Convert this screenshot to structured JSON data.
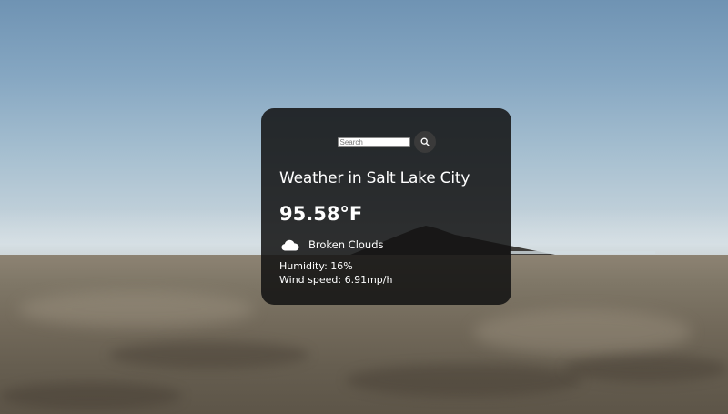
{
  "search": {
    "placeholder": "Search",
    "button_icon": "search-icon"
  },
  "weather": {
    "title": "Weather in Salt Lake City",
    "temperature": "95.58°F",
    "condition_icon": "cloud-icon",
    "description": "Broken Clouds",
    "humidity": "Humidity: 16%",
    "wind": "Wind speed: 6.91mp/h"
  },
  "colors": {
    "card_background": "#111111",
    "text": "#ffffff",
    "search_button": "#3a3a3a"
  }
}
